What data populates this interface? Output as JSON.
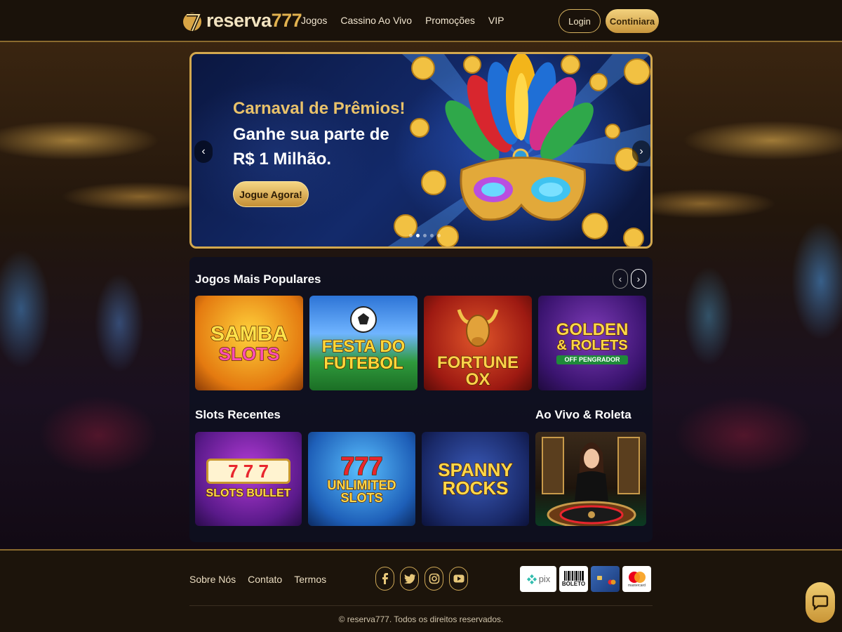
{
  "header": {
    "logo_text": "reserva",
    "logo_num": "777",
    "nav": [
      "Jogos",
      "Cassino Ao Vivo",
      "Promoções",
      "VIP"
    ],
    "login_label": "Login",
    "continue_label": "Continiara"
  },
  "hero": {
    "title": "Carnaval de Prêmios!",
    "line1": "Ganhe sua parte de",
    "line2": "R$ 1 Milhão.",
    "cta": "Jogue Agora!",
    "prev_icon": "‹",
    "next_icon": "›",
    "slide_count": 5,
    "active_slide": 1
  },
  "sections": {
    "popular_title": "Jogos Mais Populares",
    "recent_title": "Slots Recentes",
    "live_title": "Ao Vivo & Roleta",
    "prev_icon": "‹",
    "next_icon": "›"
  },
  "popular_games": [
    {
      "line1": "Samba",
      "line2": "Slots",
      "sub": ""
    },
    {
      "line1": "Festa do",
      "line2": "Futebol",
      "sub": ""
    },
    {
      "line1": "Fortune Ox",
      "line2": "",
      "sub": ""
    },
    {
      "line1": "Golden",
      "line2": "& Rolets",
      "sub": "Off Pengrador"
    }
  ],
  "recent_games": [
    {
      "line1": "7 7 7",
      "line2": "Slots Bullet"
    },
    {
      "line1": "777",
      "line2": "Unlimited Slots"
    },
    {
      "line1": "Spanny",
      "line2": "Rocks"
    }
  ],
  "footer": {
    "links": [
      "Sobre Nós",
      "Contato",
      "Termos"
    ],
    "social_icons": [
      "facebook-icon",
      "twitter-icon",
      "instagram-icon",
      "youtube-icon"
    ],
    "payments": [
      "pix",
      "BOLETO",
      "card",
      "mastercard"
    ],
    "copyright": "© reserva777. Todos os direitos reservados."
  },
  "colors": {
    "gold": "#d3a84e",
    "nav_bg": "#1a120a",
    "panel_bg": "#0e1020"
  }
}
